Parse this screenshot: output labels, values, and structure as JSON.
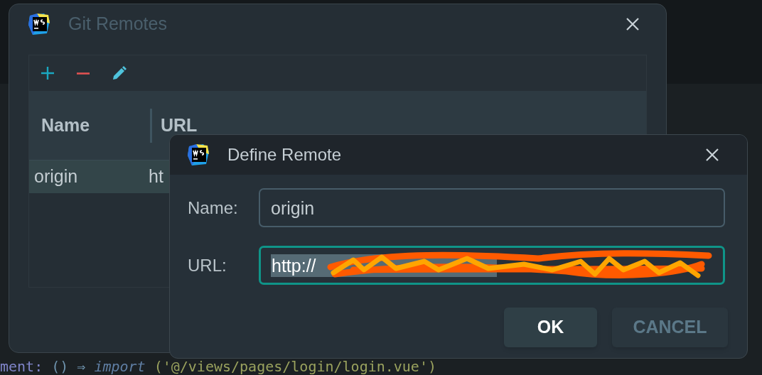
{
  "background_code": [
    {
      "kind": "property",
      "text": "ment:"
    },
    {
      "kind": "punct",
      "text": "() ⇒"
    },
    {
      "kind": "keyword",
      "text": "import"
    },
    {
      "kind": "string",
      "text": "('@/views/pages/login/login.vue')"
    }
  ],
  "git_remotes": {
    "title": "Git Remotes",
    "toolbar": [
      {
        "kind": "add"
      },
      {
        "kind": "remove"
      },
      {
        "kind": "edit"
      }
    ],
    "columns": [
      "Name",
      "URL"
    ],
    "rows": [
      {
        "name": "origin",
        "url": "ht",
        "selected": true
      }
    ]
  },
  "define_remote": {
    "title": "Define Remote",
    "fields": [
      {
        "label": "Name:",
        "value": "origin",
        "focused": false,
        "text_selected": false
      },
      {
        "label": "URL:",
        "value": "http://",
        "focused": true,
        "text_selected": true
      }
    ],
    "buttons": [
      {
        "label": "OK",
        "default": true
      },
      {
        "label": "CANCEL",
        "default": false
      }
    ]
  }
}
